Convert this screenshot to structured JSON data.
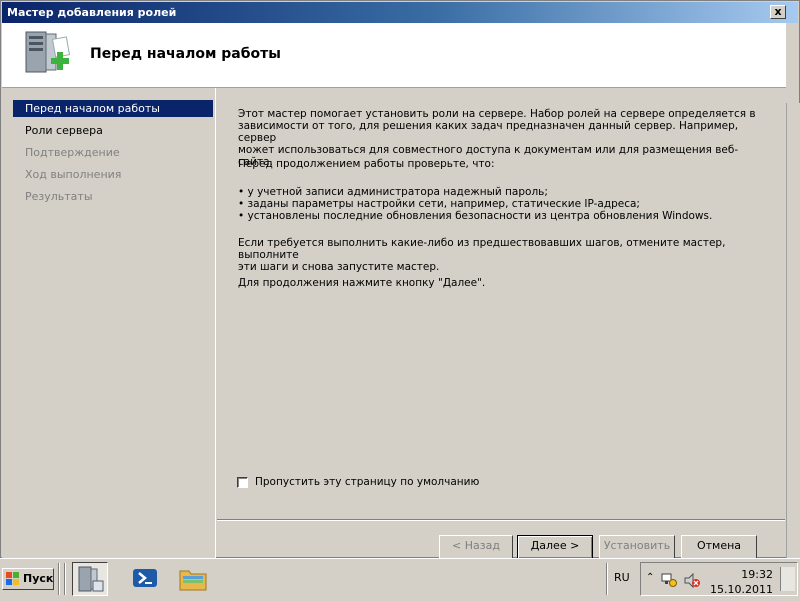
{
  "window": {
    "title": "Мастер добавления ролей",
    "close_glyph": "x"
  },
  "header": {
    "title": "Перед началом работы",
    "icon": "server-add-icon"
  },
  "nav": {
    "items": [
      {
        "label": "Перед началом работы",
        "state": "active"
      },
      {
        "label": "Роли сервера",
        "state": "enabled"
      },
      {
        "label": "Подтверждение",
        "state": "disabled"
      },
      {
        "label": "Ход выполнения",
        "state": "disabled"
      },
      {
        "label": "Результаты",
        "state": "disabled"
      }
    ]
  },
  "content": {
    "intro_lines": [
      "Этот мастер помогает установить роли на сервере. Набор ролей на сервере определяется в",
      "зависимости от того, для решения каких задач предназначен данный сервер. Например, сервер",
      "может использоваться для совместного доступа к документам или для размещения веб-сайта."
    ],
    "check_intro": "Перед продолжением работы проверьте, что:",
    "bullets": [
      "у учетной записи администратора надежный пароль;",
      "заданы параметры настройки сети, например, статические IP-адреса;",
      "установлены последние обновления безопасности из центра обновления Windows."
    ],
    "cancel_lines": [
      "Если требуется выполнить какие-либо из предшествовавших шагов, отмените мастер, выполните",
      "эти шаги и снова запустите мастер."
    ],
    "continue_text": "Для продолжения нажмите кнопку \"Далее\".",
    "skip_label": "Пропустить эту страницу по умолчанию",
    "skip_checked": false
  },
  "buttons": {
    "back": "< Назад",
    "next": "Далее >",
    "install": "Установить",
    "cancel": "Отмена"
  },
  "taskbar": {
    "start_label": "Пуск",
    "language": "RU",
    "time": "19:32",
    "date": "15.10.2011",
    "colors": {
      "accent": "#0a246a",
      "face": "#d4d0c8"
    }
  }
}
